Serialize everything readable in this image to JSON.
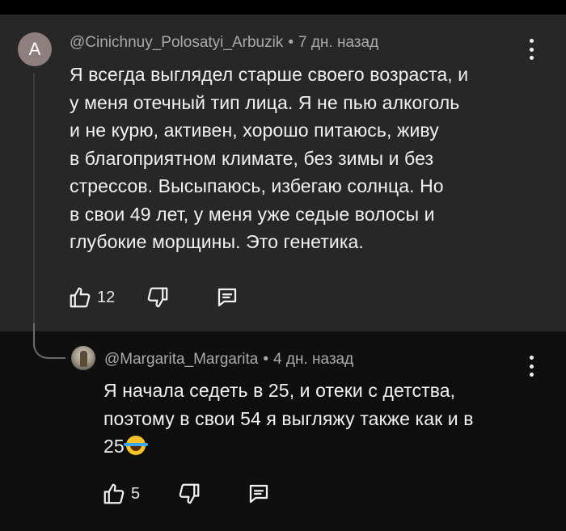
{
  "main_comment": {
    "avatar_letter": "A",
    "author": "@Cinichnuy_Polosatyi_Arbuzik",
    "separator": "•",
    "time": "7 дн. назад",
    "lines": [
      "Я всегда выглядел старше своего возраста, и",
      "у меня отечный тип лица. Я не пью алкоголь",
      "и не курю, активен, хорошо питаюсь, живу",
      "в благоприятном климате, без зимы и без",
      "стрессов. Высыпаюсь, избегаю солнца. Но",
      "в свои 49 лет, у меня уже седые волосы и",
      "глубокие морщины. Это генетика."
    ],
    "likes": "12"
  },
  "reply": {
    "author": "@Margarita_Margarita",
    "separator": "•",
    "time": "4 дн. назад",
    "lines": [
      "Я начала седеть в 25, и отеки с детства,",
      "поэтому в свои 54 я выгляжу также как и в",
      "25"
    ],
    "emoji": "laughing-with-tears",
    "likes": "5"
  },
  "icons": {
    "like": "thumbs-up-icon",
    "dislike": "thumbs-down-icon",
    "reply": "reply-bubble-icon",
    "menu": "kebab-menu-icon"
  },
  "colors": {
    "background": "#0f0f0f",
    "comment_highlight": "#272727",
    "text": "#f1f1f1",
    "meta": "#aaaaaa"
  }
}
